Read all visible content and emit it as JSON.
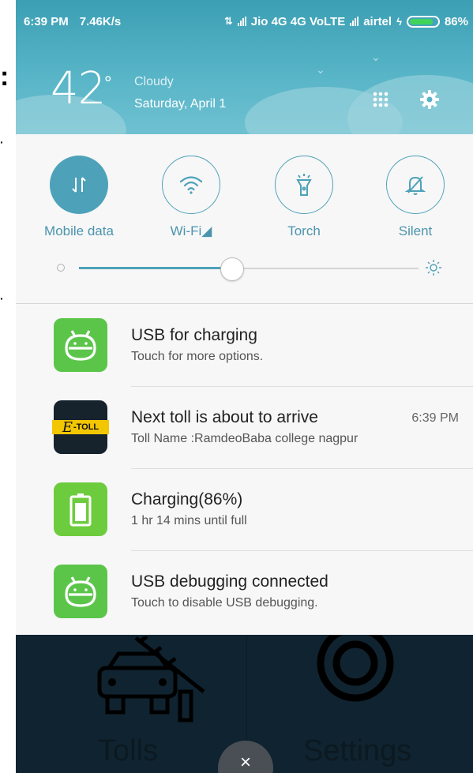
{
  "status_bar": {
    "time": "6:39 PM",
    "speed": "7.46K/s",
    "carrier1": "Jio 4G 4G VoLTE",
    "carrier2": "airtel",
    "battery": "86%",
    "battery_level": 0.86,
    "battery_color": "#41d35b"
  },
  "header": {
    "temperature": "42",
    "degree": "°",
    "condition": "Cloudy",
    "date": "Saturday, April 1",
    "icons": [
      "apps-grid-icon",
      "gear-icon"
    ],
    "bg_color": "#4eabc0"
  },
  "quick_settings": {
    "toggles": [
      {
        "label": "Mobile data",
        "icon": "mobile-data-icon",
        "active": true
      },
      {
        "label": "Wi-Fi◢",
        "icon": "wifi-icon",
        "active": false
      },
      {
        "label": "Torch",
        "icon": "torch-icon",
        "active": false
      },
      {
        "label": "Silent",
        "icon": "silent-bell-icon",
        "active": false
      }
    ],
    "brightness_level": 0.45,
    "accent_color": "#4da1b9"
  },
  "notifications": [
    {
      "title": "USB for charging",
      "text": "Touch for more options.",
      "time": "",
      "icon": "android-icon"
    },
    {
      "title": "Next toll is about to arrive",
      "text": "Toll Name :RamdeoBaba college nagpur",
      "time": "6:39 PM",
      "icon": "etoll-icon",
      "icon_letter": "E",
      "icon_word": "-TOLL"
    },
    {
      "title": "Charging(86%)",
      "text": "1 hr 14 mins until full",
      "time": "",
      "icon": "battery-icon"
    },
    {
      "title": "USB debugging connected",
      "text": "Touch to disable USB debugging.",
      "time": "",
      "icon": "android-icon"
    }
  ],
  "background_app": {
    "tabs": [
      "Tolls",
      "Settings"
    ],
    "close_icon": "close-icon",
    "close_glyph": "×"
  }
}
